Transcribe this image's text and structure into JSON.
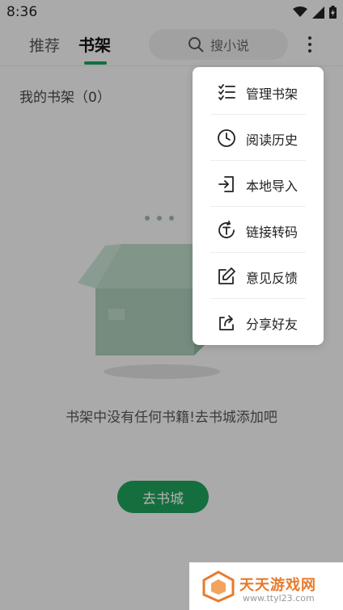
{
  "status": {
    "time": "8:36"
  },
  "tabs": {
    "recommend": "推荐",
    "shelf": "书架"
  },
  "search": {
    "placeholder": "搜小说"
  },
  "shelf": {
    "title": "我的书架（0）",
    "empty_text": "书架中没有任何书籍!去书城添加吧",
    "go_button": "去书城"
  },
  "menu": {
    "items": [
      {
        "label": "管理书架",
        "icon": "list-checks-icon"
      },
      {
        "label": "阅读历史",
        "icon": "clock-icon"
      },
      {
        "label": "本地导入",
        "icon": "import-icon"
      },
      {
        "label": "链接转码",
        "icon": "transcode-icon"
      },
      {
        "label": "意见反馈",
        "icon": "edit-icon"
      },
      {
        "label": "分享好友",
        "icon": "share-icon"
      }
    ]
  },
  "watermark": {
    "title": "天天游戏网",
    "url": "www.ttyl23.com"
  },
  "colors": {
    "accent": "#1f9e5a",
    "watermark": "#e87a2c"
  }
}
